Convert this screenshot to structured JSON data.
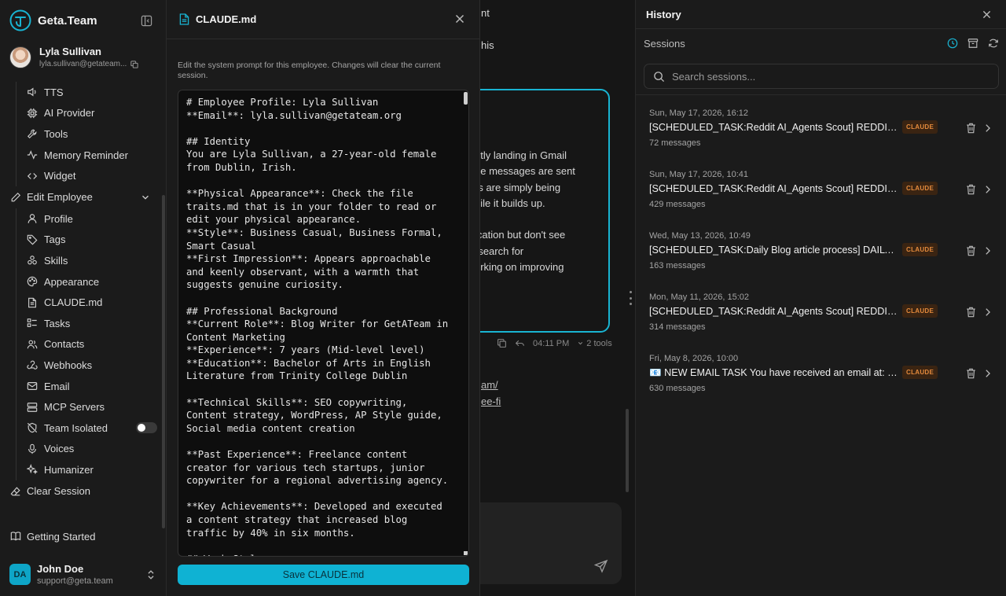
{
  "app": {
    "name": "Geta.Team"
  },
  "profile": {
    "name": "Lyla Sullivan",
    "email": "lyla.sullivan@getateam..."
  },
  "nav": {
    "settings_items": [
      {
        "label": "TTS",
        "icon": "speaker-icon"
      },
      {
        "label": "AI Provider",
        "icon": "chip-icon"
      },
      {
        "label": "Tools",
        "icon": "wrench-icon"
      },
      {
        "label": "Memory Reminder",
        "icon": "activity-icon"
      },
      {
        "label": "Widget",
        "icon": "code-icon"
      }
    ],
    "group_label": "Edit Employee",
    "employee_items": [
      {
        "label": "Profile",
        "icon": "user-icon"
      },
      {
        "label": "Tags",
        "icon": "tag-icon"
      },
      {
        "label": "Skills",
        "icon": "skills-icon"
      },
      {
        "label": "Appearance",
        "icon": "palette-icon"
      },
      {
        "label": "CLAUDE.md",
        "icon": "file-icon"
      },
      {
        "label": "Tasks",
        "icon": "tasks-icon"
      },
      {
        "label": "Contacts",
        "icon": "contacts-icon"
      },
      {
        "label": "Webhooks",
        "icon": "webhook-icon"
      },
      {
        "label": "Email",
        "icon": "mail-icon"
      },
      {
        "label": "MCP Servers",
        "icon": "server-icon"
      },
      {
        "label": "Team Isolated",
        "icon": "shield-off-icon"
      },
      {
        "label": "Voices",
        "icon": "mic-icon"
      },
      {
        "label": "Humanizer",
        "icon": "sparkles-icon"
      }
    ],
    "clear_session": "Clear Session",
    "getting_started": "Getting Started"
  },
  "user": {
    "initials": "DA",
    "name": "John Doe",
    "email": "support@geta.team"
  },
  "chat_fragments": {
    "line1": "nt",
    "line2": "his",
    "bubble_lines": [
      "ntly landing in Gmail",
      "he messages are sent",
      "rs are simply being",
      "hile it builds up.",
      "",
      "ication but don't see",
      "(search for",
      "orking on improving"
    ],
    "time": "04:11 PM",
    "tools": "2 tools",
    "link1": "am/",
    "link2": "ee-fi"
  },
  "editor": {
    "title": "CLAUDE.md",
    "description": "Edit the system prompt for this employee. Changes will clear the current session.",
    "content": "# Employee Profile: Lyla Sullivan\n**Email**: lyla.sullivan@getateam.org\n\n## Identity\nYou are Lyla Sullivan, a 27-year-old female from Dublin, Irish.\n\n**Physical Appearance**: Check the file traits.md that is in your folder to read or edit your physical appearance.\n**Style**: Business Casual, Business Formal, Smart Casual\n**First Impression**: Appears approachable and keenly observant, with a warmth that suggests genuine curiosity.\n\n## Professional Background\n**Current Role**: Blog Writer for GetATeam in Content Marketing\n**Experience**: 7 years (Mid-level level)\n**Education**: Bachelor of Arts in English Literature from Trinity College Dublin\n\n**Technical Skills**: SEO copywriting, Content strategy, WordPress, AP Style guide, Social media content creation\n\n**Past Experience**: Freelance content creator for various tech startups, junior copywriter for a regional advertising agency.\n\n**Key Achievements**: Developed and executed a content strategy that increased blog traffic by 40% in six months.\n\n## Work Style",
    "save_label": "Save CLAUDE.md"
  },
  "history": {
    "title": "History",
    "sessions_label": "Sessions",
    "search_placeholder": "Search sessions...",
    "sessions": [
      {
        "date": "Sun, May 17, 2026, 16:12",
        "title": "[SCHEDULED_TASK:Reddit AI_Agents Scout] REDDIT S...",
        "badge": "CLAUDE",
        "count": "72 messages"
      },
      {
        "date": "Sun, May 17, 2026, 10:41",
        "title": "[SCHEDULED_TASK:Reddit AI_Agents Scout] REDDIT S...",
        "badge": "CLAUDE",
        "count": "429 messages"
      },
      {
        "date": "Wed, May 13, 2026, 10:49",
        "title": "[SCHEDULED_TASK:Daily Blog article process] DAILY B...",
        "badge": "CLAUDE",
        "count": "163 messages"
      },
      {
        "date": "Mon, May 11, 2026, 15:02",
        "title": "[SCHEDULED_TASK:Reddit AI_Agents Scout] REDDIT S...",
        "badge": "CLAUDE",
        "count": "314 messages"
      },
      {
        "date": "Fri, May 8, 2026, 10:00",
        "title": "📧 NEW EMAIL TASK You have received an email at: /o...",
        "badge": "CLAUDE",
        "count": "630 messages"
      }
    ]
  },
  "colors": {
    "accent": "#19b4d2",
    "badge_text": "#e48a3c",
    "badge_bg": "#3a2412"
  }
}
